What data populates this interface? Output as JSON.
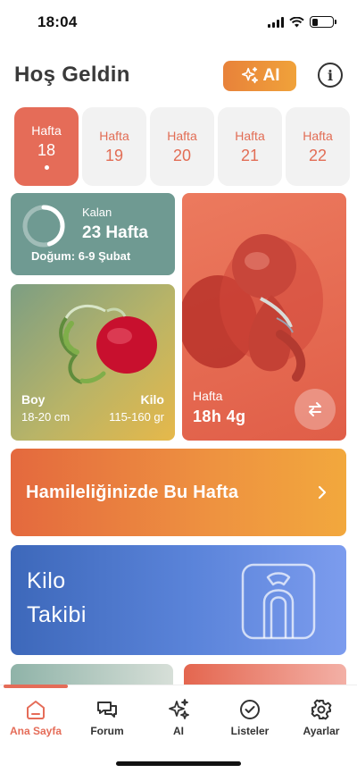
{
  "status_bar": {
    "time": "18:04"
  },
  "header": {
    "title": "Hoş Geldin",
    "ai_label": "AI",
    "info_icon": "info-icon"
  },
  "weeks": [
    {
      "label": "Hafta",
      "number": "18",
      "active": true
    },
    {
      "label": "Hafta",
      "number": "19",
      "active": false
    },
    {
      "label": "Hafta",
      "number": "20",
      "active": false
    },
    {
      "label": "Hafta",
      "number": "21",
      "active": false
    },
    {
      "label": "Hafta",
      "number": "22",
      "active": false
    }
  ],
  "remaining": {
    "label": "Kalan",
    "value": "23 Hafta",
    "due": "Doğum: 6-9 Şubat",
    "progress": 0.45
  },
  "size": {
    "weight_label": "Kilo",
    "length_label": "Boy",
    "length_value": "18-20 cm",
    "weight_value": "115-160 gr",
    "image": "radish-image"
  },
  "baby": {
    "label": "Hafta",
    "value": "18h 4g",
    "image": "fetus-image",
    "swap_icon": "swap-icon"
  },
  "week_card": {
    "title": "Hamileliğinizde Bu Hafta",
    "icon": "chevron-right-icon"
  },
  "kilo_card": {
    "line1": "Kilo",
    "line2": "Takibi",
    "icon": "scale-icon"
  },
  "tabbar": {
    "items": [
      {
        "label": "Ana Sayfa",
        "icon": "home-icon",
        "active": true
      },
      {
        "label": "Forum",
        "icon": "chat-icon",
        "active": false
      },
      {
        "label": "AI",
        "icon": "sparkle-icon",
        "active": false
      },
      {
        "label": "Listeler",
        "icon": "check-circle-icon",
        "active": false
      },
      {
        "label": "Ayarlar",
        "icon": "gear-icon",
        "active": false
      }
    ]
  },
  "colors": {
    "accent": "#e56c58",
    "teal": "#6f9a92",
    "orange": "#ee9240",
    "blue": "#5b84da"
  }
}
